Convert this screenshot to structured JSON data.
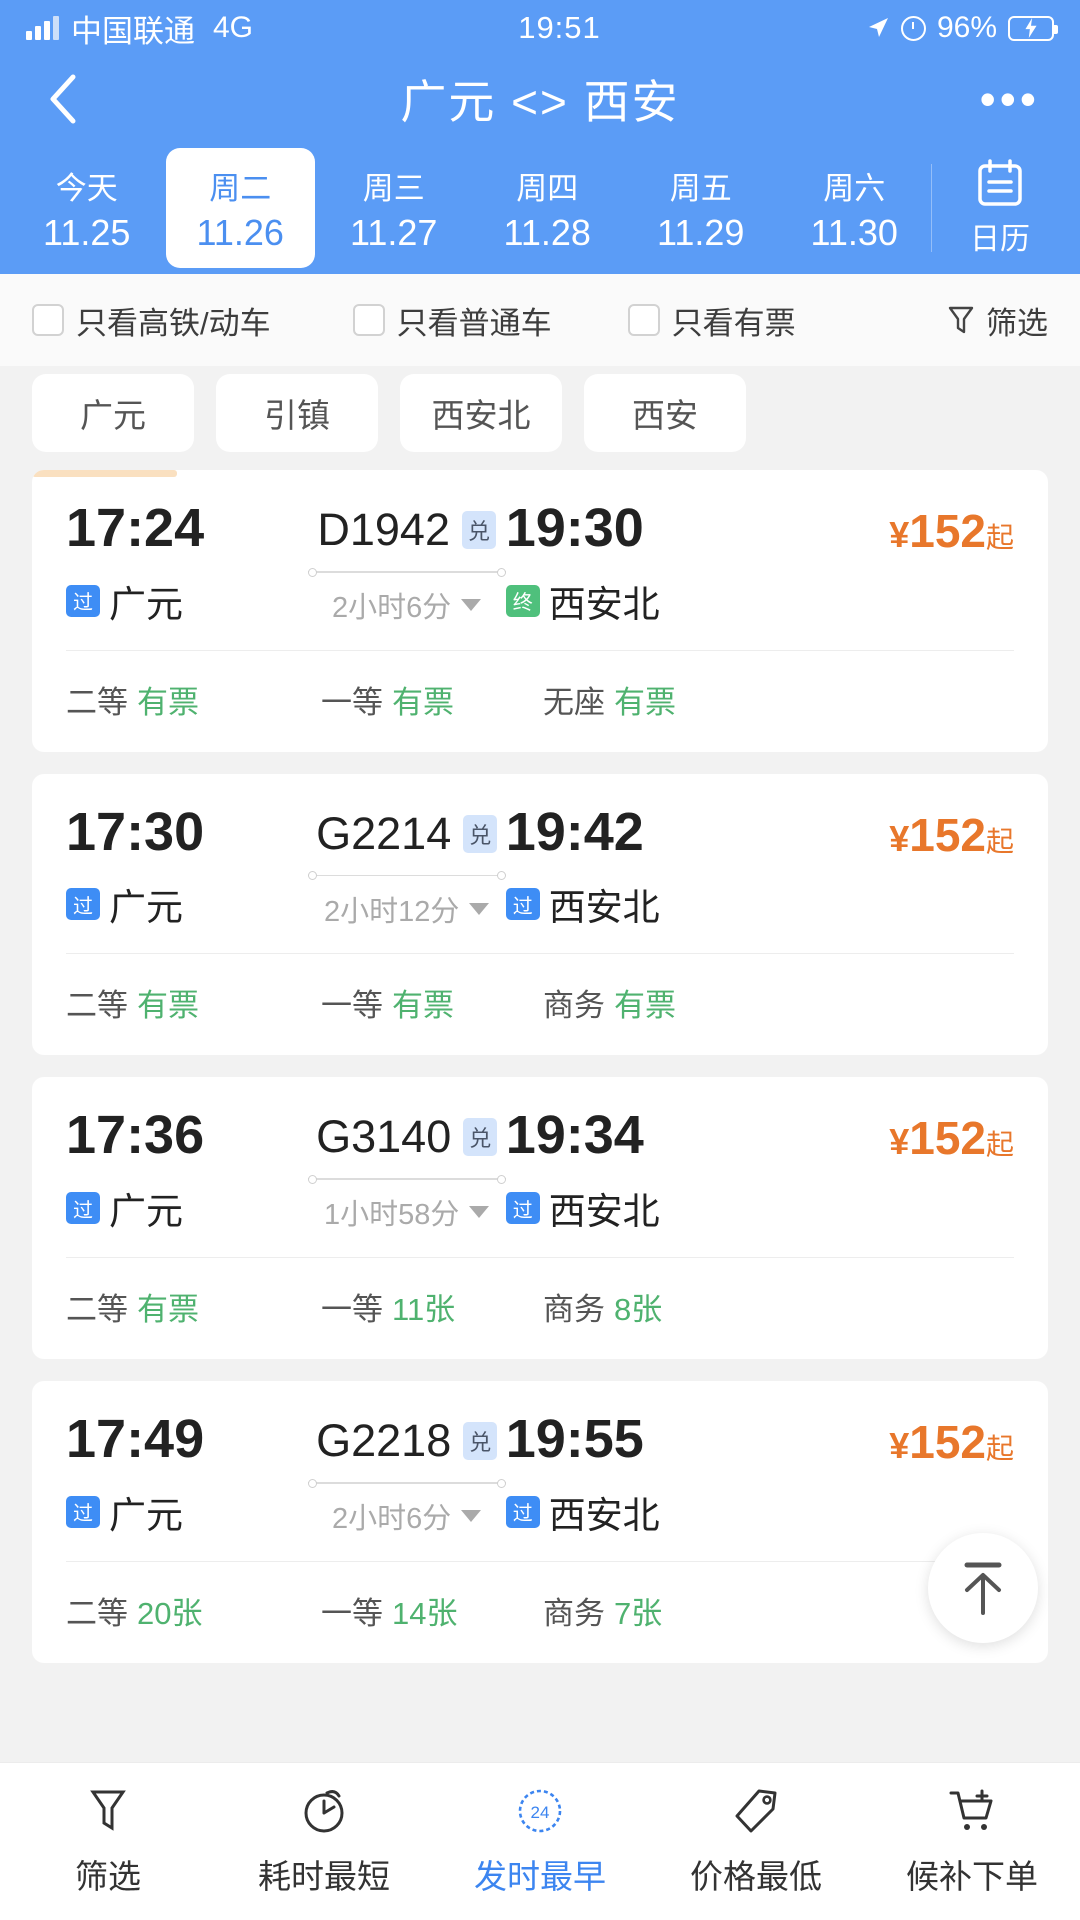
{
  "status_bar": {
    "carrier": "中国联通",
    "network": "4G",
    "time": "19:51",
    "battery_percent": "96%",
    "icons": [
      "signal-icon",
      "location-arrow-icon",
      "alarm-icon",
      "battery-charging-icon"
    ]
  },
  "header": {
    "title": "广元 <> 西安",
    "back_icon": "chevron-left-icon",
    "more_icon": "more-dots-icon",
    "calendar": {
      "label": "日历",
      "icon": "calendar-icon"
    },
    "dates": [
      {
        "dow": "今天",
        "date": "11.25",
        "active": false
      },
      {
        "dow": "周二",
        "date": "11.26",
        "active": true
      },
      {
        "dow": "周三",
        "date": "11.27",
        "active": false
      },
      {
        "dow": "周四",
        "date": "11.28",
        "active": false
      },
      {
        "dow": "周五",
        "date": "11.29",
        "active": false
      },
      {
        "dow": "周六",
        "date": "11.30",
        "active": false
      }
    ]
  },
  "filter_bar": {
    "checkboxes": [
      {
        "label": "只看高铁/动车",
        "checked": false
      },
      {
        "label": "只看普通车",
        "checked": false
      },
      {
        "label": "只看有票",
        "checked": false
      }
    ],
    "filter_button": {
      "label": "筛选",
      "icon": "funnel-icon"
    }
  },
  "station_chips": [
    "广元",
    "引镇",
    "西安北",
    "西安"
  ],
  "trains": [
    {
      "depart_time": "17:24",
      "depart_badge": "过",
      "depart_badge_type": "pass",
      "depart_station": "广元",
      "train_no": "D1942",
      "exchange_badge": "兑",
      "duration": "2小时6分",
      "arrive_time": "19:30",
      "arrive_badge": "终",
      "arrive_badge_type": "end",
      "arrive_station": "西安北",
      "price": "152",
      "price_symbol": "¥",
      "price_suffix": "起",
      "highlighted": true,
      "seats": [
        {
          "type": "二等",
          "count": "有票"
        },
        {
          "type": "一等",
          "count": "有票"
        },
        {
          "type": "无座",
          "count": "有票"
        }
      ]
    },
    {
      "depart_time": "17:30",
      "depart_badge": "过",
      "depart_badge_type": "pass",
      "depart_station": "广元",
      "train_no": "G2214",
      "exchange_badge": "兑",
      "duration": "2小时12分",
      "arrive_time": "19:42",
      "arrive_badge": "过",
      "arrive_badge_type": "pass",
      "arrive_station": "西安北",
      "price": "152",
      "price_symbol": "¥",
      "price_suffix": "起",
      "highlighted": false,
      "seats": [
        {
          "type": "二等",
          "count": "有票"
        },
        {
          "type": "一等",
          "count": "有票"
        },
        {
          "type": "商务",
          "count": "有票"
        }
      ]
    },
    {
      "depart_time": "17:36",
      "depart_badge": "过",
      "depart_badge_type": "pass",
      "depart_station": "广元",
      "train_no": "G3140",
      "exchange_badge": "兑",
      "duration": "1小时58分",
      "arrive_time": "19:34",
      "arrive_badge": "过",
      "arrive_badge_type": "pass",
      "arrive_station": "西安北",
      "price": "152",
      "price_symbol": "¥",
      "price_suffix": "起",
      "highlighted": false,
      "seats": [
        {
          "type": "二等",
          "count": "有票"
        },
        {
          "type": "一等",
          "count": "11张"
        },
        {
          "type": "商务",
          "count": "8张"
        }
      ]
    },
    {
      "depart_time": "17:49",
      "depart_badge": "过",
      "depart_badge_type": "pass",
      "depart_station": "广元",
      "train_no": "G2218",
      "exchange_badge": "兑",
      "duration": "2小时6分",
      "arrive_time": "19:55",
      "arrive_badge": "过",
      "arrive_badge_type": "pass",
      "arrive_station": "西安北",
      "price": "152",
      "price_symbol": "¥",
      "price_suffix": "起",
      "highlighted": false,
      "seats": [
        {
          "type": "二等",
          "count": "20张"
        },
        {
          "type": "一等",
          "count": "14张"
        },
        {
          "type": "商务",
          "count": "7张"
        }
      ]
    }
  ],
  "scroll_top_button": {
    "icon": "scroll-to-top-icon"
  },
  "tab_bar": [
    {
      "label": "筛选",
      "icon": "funnel-icon",
      "active": false
    },
    {
      "label": "耗时最短",
      "icon": "stopwatch-icon",
      "active": false
    },
    {
      "label": "发时最早",
      "icon": "clock-24-icon",
      "active": true
    },
    {
      "label": "价格最低",
      "icon": "price-tag-icon",
      "active": false
    },
    {
      "label": "候补下单",
      "icon": "cart-plus-icon",
      "active": false
    }
  ],
  "colors": {
    "brand_blue": "#5b9cf6",
    "price_orange": "#e8772b",
    "seat_green": "#4fb26f",
    "pass_badge_blue": "#3e8df5",
    "end_badge_green": "#4fc07c",
    "accent_bar": "#fae0c0"
  }
}
